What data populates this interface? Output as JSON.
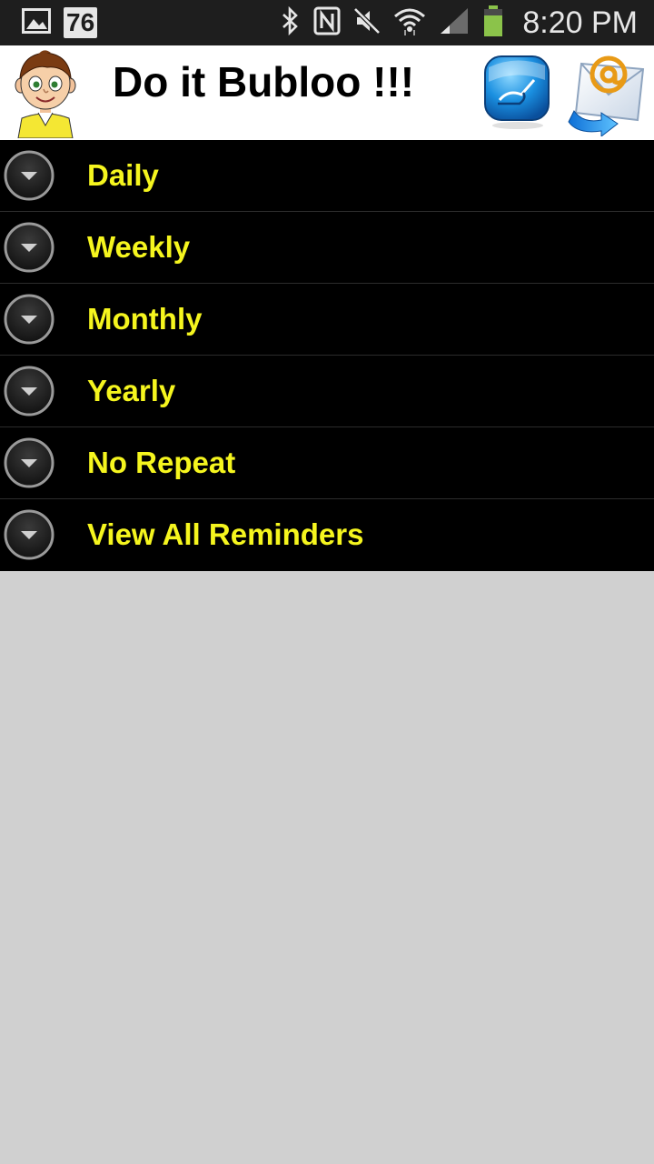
{
  "status_bar": {
    "icons_left": [
      "image-icon",
      "calendar-badge-icon"
    ],
    "badge_number": "76",
    "icons_right": [
      "bluetooth-icon",
      "nfc-icon",
      "mute-icon",
      "wifi-icon",
      "signal-icon",
      "battery-icon"
    ],
    "time": "8:20 PM"
  },
  "header": {
    "title": "Do it Bubloo !!!",
    "avatar": "boy-avatar",
    "action_icons": [
      "hand-writing-icon",
      "email-send-icon"
    ]
  },
  "menu": {
    "items": [
      {
        "label": "Daily",
        "icon": "chevron-down-icon"
      },
      {
        "label": "Weekly",
        "icon": "chevron-down-icon"
      },
      {
        "label": "Monthly",
        "icon": "chevron-down-icon"
      },
      {
        "label": "Yearly",
        "icon": "chevron-down-icon"
      },
      {
        "label": "No Repeat",
        "icon": "chevron-down-icon"
      },
      {
        "label": "View All Reminders",
        "icon": "chevron-down-icon"
      }
    ]
  },
  "colors": {
    "status_bar_bg": "#1e1e1e",
    "header_bg": "#ffffff",
    "menu_bg": "#000000",
    "menu_text": "#f5f51e",
    "page_bg": "#d0d0d0",
    "battery": "#8bc34a"
  }
}
